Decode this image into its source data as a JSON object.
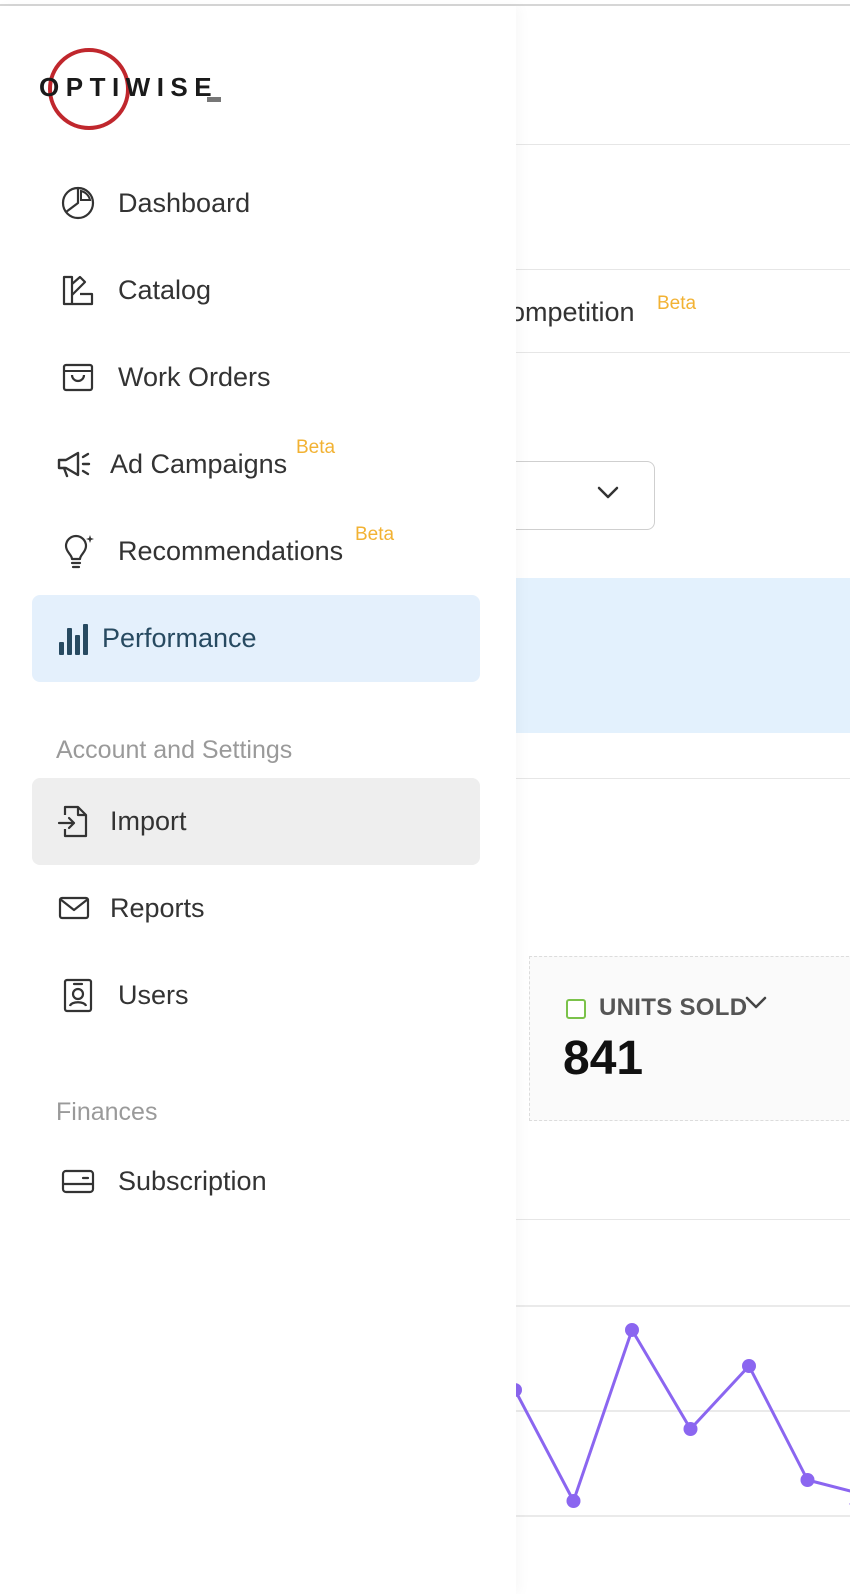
{
  "background": {
    "tab_partial_label": "ompetition",
    "tab_badge": "Beta",
    "metric": {
      "label": "UNITS SOLD",
      "value": "841",
      "checkbox_color": "#7bc24a"
    },
    "banner_color": "#e3f1fd",
    "chart_data": {
      "type": "line",
      "series": [
        {
          "values": [
            42,
            5,
            62,
            29,
            50,
            12,
            7
          ]
        }
      ],
      "color": "#8b66f0",
      "grid": true
    }
  },
  "sidebar": {
    "logo_text": "OPTIWISE",
    "logo_color": "#c0272d",
    "items": [
      {
        "label": "Dashboard",
        "icon": "pie-chart-icon"
      },
      {
        "label": "Catalog",
        "icon": "catalog-icon"
      },
      {
        "label": "Work Orders",
        "icon": "shopping-bag-icon"
      },
      {
        "label": "Ad Campaigns",
        "icon": "megaphone-icon",
        "badge": "Beta"
      },
      {
        "label": "Recommendations",
        "icon": "lightbulb-icon",
        "badge": "Beta"
      },
      {
        "label": "Performance",
        "icon": "bar-chart-icon",
        "active": true
      }
    ],
    "account_section": {
      "title": "Account and Settings",
      "items": [
        {
          "label": "Import",
          "icon": "file-import-icon",
          "hovered": true
        },
        {
          "label": "Reports",
          "icon": "mail-icon"
        },
        {
          "label": "Users",
          "icon": "user-badge-icon"
        }
      ]
    },
    "finances_section": {
      "title": "Finances",
      "items": [
        {
          "label": "Subscription",
          "icon": "credit-card-icon"
        }
      ]
    },
    "accent_color": "#f2b233",
    "active_bg": "#e4f0fc"
  }
}
